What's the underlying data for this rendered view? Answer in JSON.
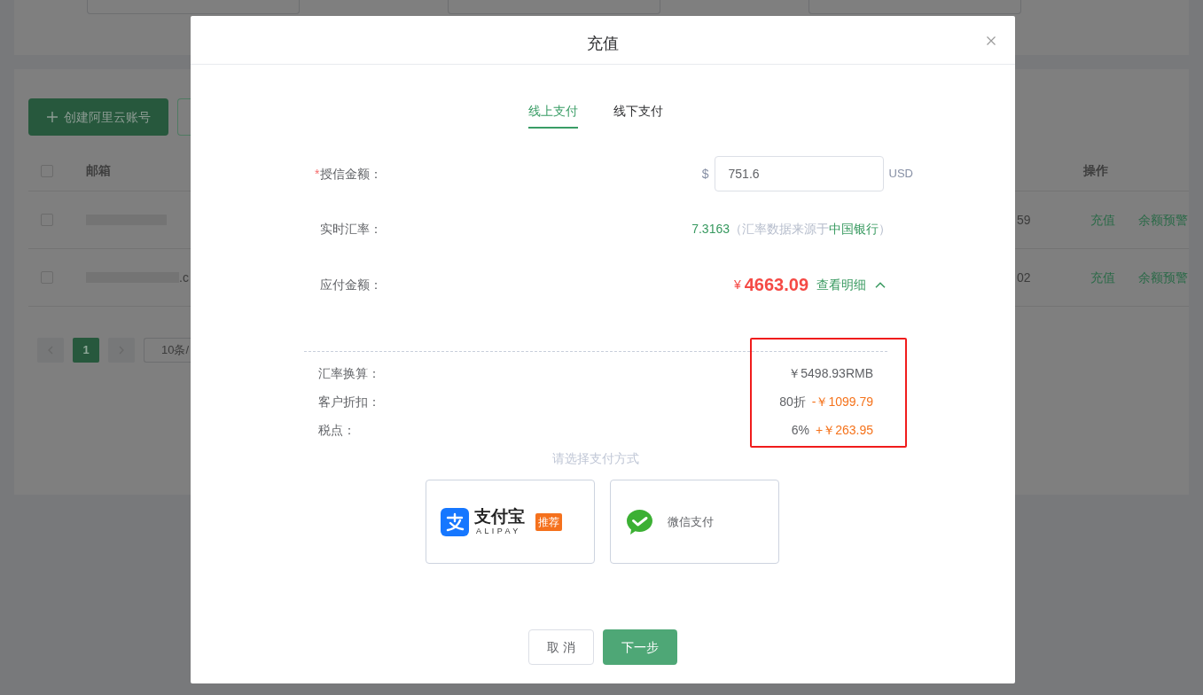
{
  "background_page": {
    "filters": [
      {
        "kind": "input"
      },
      {
        "kind": "input"
      },
      {
        "kind": "input"
      }
    ],
    "toolbar": [
      {
        "kind": "primary",
        "label": "创建阿里云账号"
      },
      {
        "kind": "outline"
      }
    ],
    "table": {
      "select_all": {
        "checked": false
      },
      "columns": [
        {
          "label": "邮箱"
        },
        {
          "label": "操作"
        }
      ],
      "rows": [
        {
          "checked": false,
          "email_blurred": true,
          "column_3": "59",
          "actions": [
            "充值",
            "余额预警"
          ]
        },
        {
          "checked": false,
          "email_blurred": true,
          "email_tail": ".c",
          "column_3": "02",
          "actions": [
            "充值",
            "余额预警"
          ]
        }
      ]
    },
    "pagination": {
      "pages": [
        {
          "label": "1",
          "selected": true
        }
      ],
      "page_size": "10条/"
    }
  },
  "dialog": {
    "title": "充值",
    "tabs": [
      {
        "label": "线上支付",
        "selected": true
      },
      {
        "label": "线下支付",
        "selected": false
      }
    ],
    "form": [
      {
        "kind": "input",
        "required_mark": "*",
        "label": "授信金额：",
        "prefix": "$",
        "value": "751.6",
        "suffix": "USD"
      },
      {
        "kind": "rate",
        "label": "实时汇率：",
        "rate": "7.3163",
        "note_before": "（汇率数据来源于",
        "source": "中国银行",
        "note_after": "）"
      },
      {
        "kind": "amount",
        "label": "应付金额：",
        "currency": "¥",
        "amount": "4663.09",
        "link": "查看明细",
        "expanded": true
      }
    ],
    "breakdown": {
      "highlighted": true,
      "rows": [
        {
          "kind": "conversion",
          "label": "汇率换算：",
          "value": "￥5498.93RMB"
        },
        {
          "kind": "adjustment",
          "label": "客户折扣：",
          "note": "80折",
          "value": "-￥1099.79"
        },
        {
          "kind": "adjustment",
          "label": "税点：",
          "note": "6%",
          "value": "+￥263.95"
        }
      ]
    },
    "payment_prompt": "请选择支付方式",
    "payment_methods": [
      {
        "kind": "alipay",
        "name": "支付宝",
        "subtitle": "ALIPAY",
        "badge": "推荐",
        "selected": false
      },
      {
        "kind": "wechat",
        "name": "微信支付",
        "selected": false
      }
    ],
    "buttons": [
      {
        "kind": "default",
        "label": "取 消"
      },
      {
        "kind": "primary",
        "label": "下一步"
      }
    ]
  }
}
